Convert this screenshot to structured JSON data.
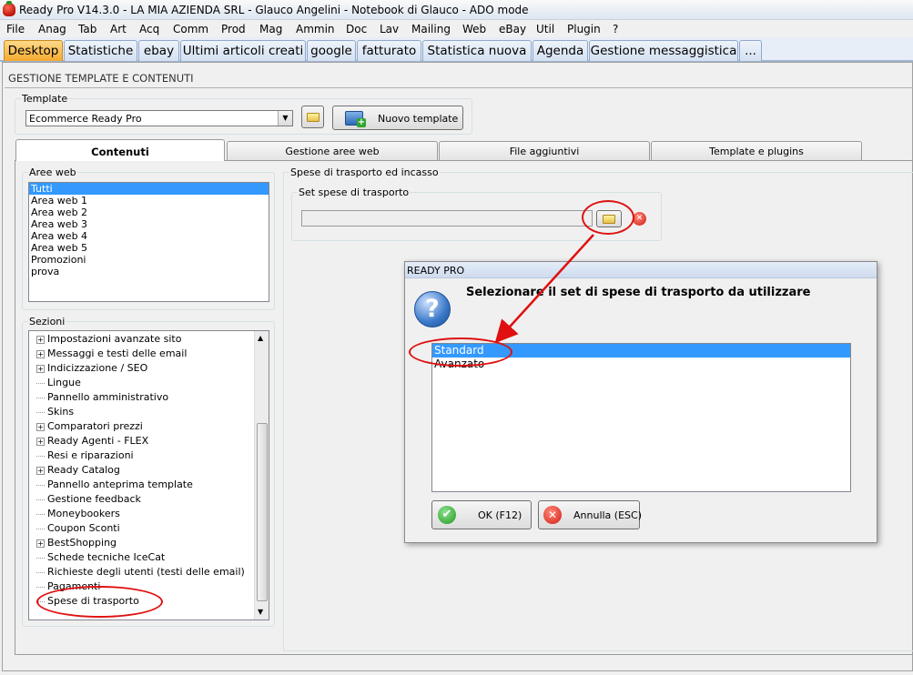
{
  "window": {
    "title": "Ready Pro V14.3.0 - LA MIA AZIENDA SRL - Glauco Angelini - Notebook di Glauco - ADO mode",
    "icon": "strawberry-icon"
  },
  "menu": [
    "File",
    "Anag",
    "Tab",
    "Art",
    "Acq",
    "Comm",
    "Prod",
    "Mag",
    "Ammin",
    "Doc",
    "Lav",
    "Mailing",
    "Web",
    "eBay",
    "Util",
    "Plugin",
    "?"
  ],
  "desktop_tabs": [
    "Desktop",
    "Statistiche",
    "ebay",
    "Ultimi articoli creati",
    "google",
    "fatturato",
    "Statistica nuova",
    "Agenda",
    "Gestione messaggistica",
    "..."
  ],
  "section_title": "GESTIONE TEMPLATE E CONTENUTI",
  "template": {
    "group_label": "Template",
    "selected": "Ecommerce Ready Pro",
    "new_button": "Nuovo template"
  },
  "panel_tabs": [
    "Contenuti",
    "Gestione aree web",
    "File aggiuntivi",
    "Template e plugins"
  ],
  "aree_web": {
    "label": "Aree web",
    "items": [
      "Tutti",
      "Area web 1",
      "Area web 2",
      "Area web 3",
      "Area web 4",
      "Area web 5",
      "Promozioni",
      "prova"
    ],
    "selected": "Tutti"
  },
  "sezioni": {
    "label": "Sezioni",
    "items": [
      {
        "label": "Impostazioni avanzate sito",
        "expandable": true
      },
      {
        "label": "Messaggi e testi delle email",
        "expandable": true
      },
      {
        "label": "Indicizzazione / SEO",
        "expandable": true
      },
      {
        "label": "Lingue",
        "expandable": false
      },
      {
        "label": "Pannello amministrativo",
        "expandable": false
      },
      {
        "label": "Skins",
        "expandable": false
      },
      {
        "label": "Comparatori prezzi",
        "expandable": true
      },
      {
        "label": "Ready Agenti - FLEX",
        "expandable": true
      },
      {
        "label": "Resi e riparazioni",
        "expandable": false
      },
      {
        "label": "Ready Catalog",
        "expandable": true
      },
      {
        "label": "Pannello anteprima template",
        "expandable": false
      },
      {
        "label": "Gestione feedback",
        "expandable": false
      },
      {
        "label": "Moneybookers",
        "expandable": false
      },
      {
        "label": "Coupon Sconti",
        "expandable": false
      },
      {
        "label": "BestShopping",
        "expandable": true
      },
      {
        "label": "Schede tecniche IceCat",
        "expandable": false
      },
      {
        "label": "Richieste degli utenti (testi delle email)",
        "expandable": false
      },
      {
        "label": "Pagamenti",
        "expandable": false
      },
      {
        "label": "Spese di trasporto",
        "expandable": false
      }
    ]
  },
  "right": {
    "group_label": "Spese di trasporto ed incasso",
    "sub_label": "Set spese di trasporto",
    "value": ""
  },
  "dialog": {
    "title": "READY PRO",
    "message": "Selezionare il set di spese di trasporto da utilizzare",
    "options": [
      "Standard",
      "Avanzato"
    ],
    "selected": "Standard",
    "ok": "OK (F12)",
    "cancel": "Annulla (ESC)"
  },
  "colors": {
    "selection": "#3399ff",
    "annotation": "#e01010",
    "active_tab": "#f4a92f"
  }
}
